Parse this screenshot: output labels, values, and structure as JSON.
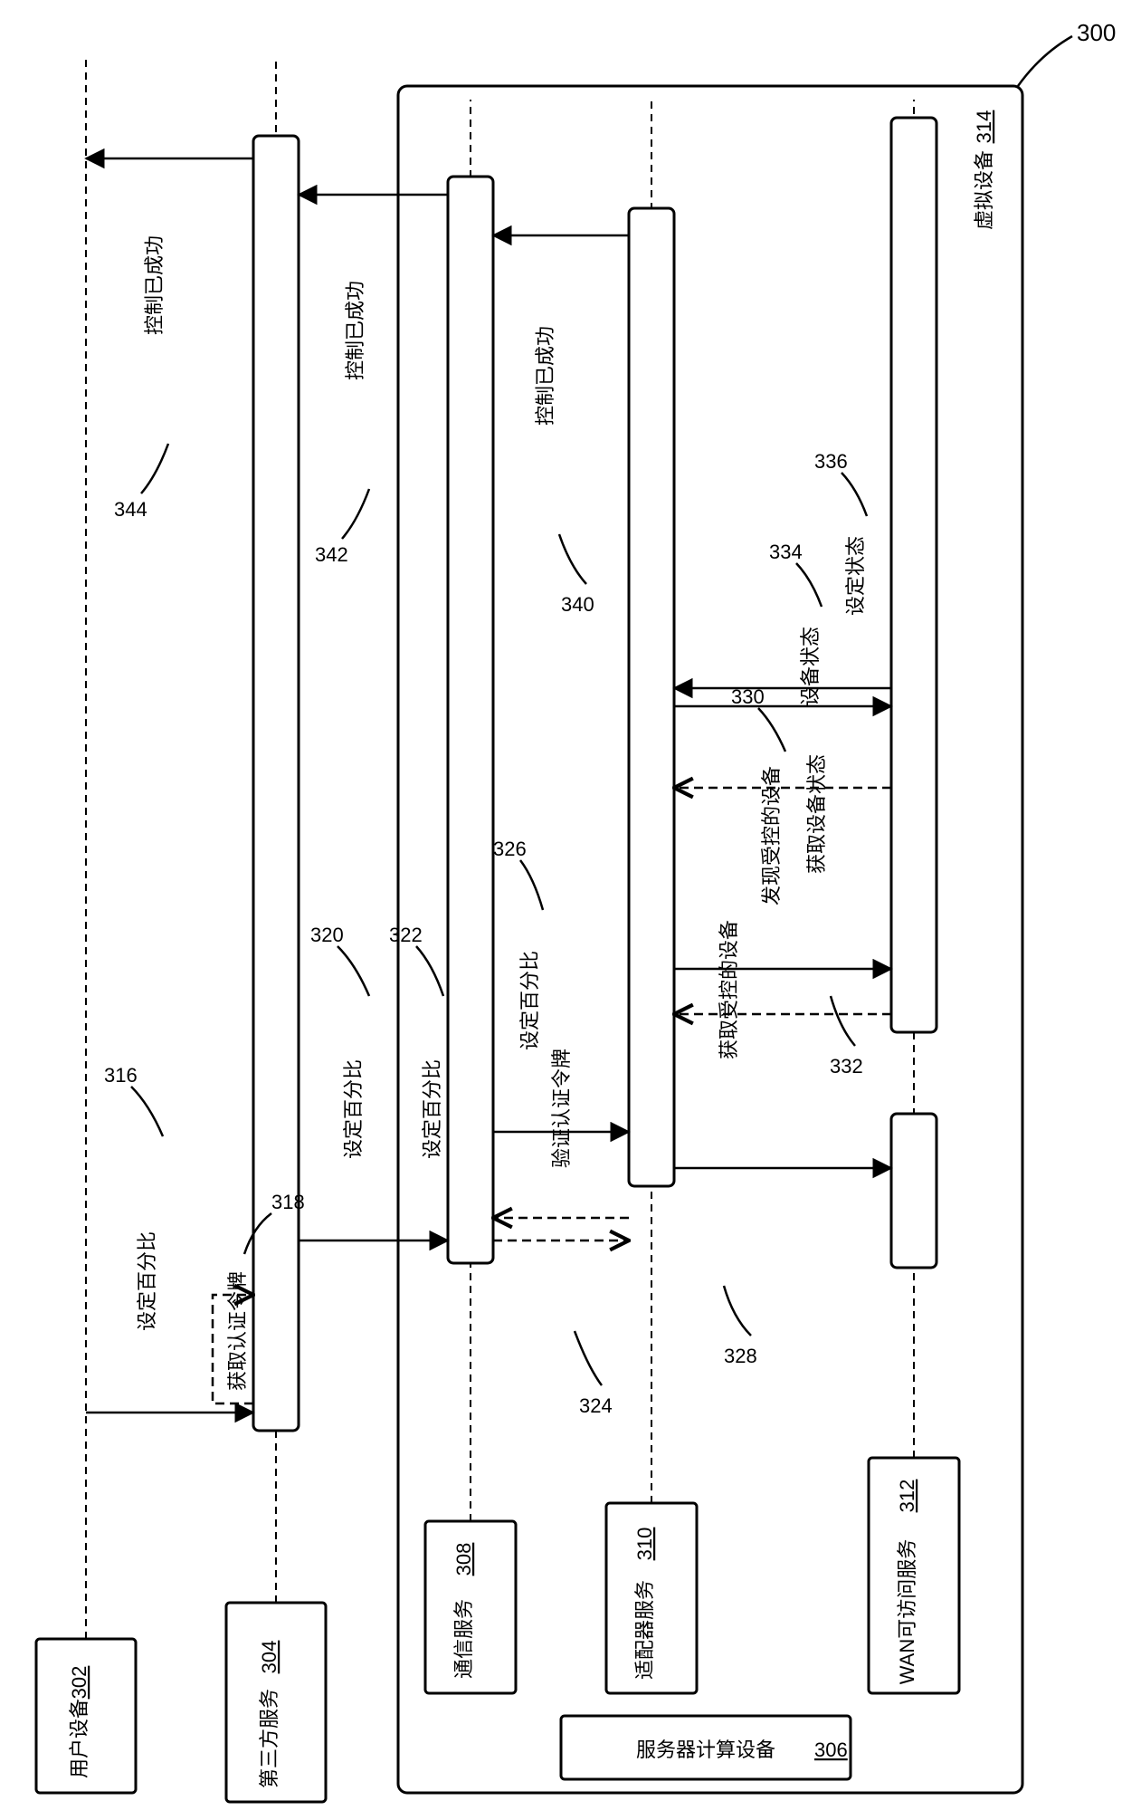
{
  "figure_ref": "300",
  "participants": {
    "user_device": {
      "label": "用户设备",
      "ref": "302"
    },
    "third_party": {
      "label": "第三方服务",
      "ref": "304"
    },
    "server": {
      "label": "服务器计算设备",
      "ref": "306"
    },
    "comm_svc": {
      "label": "通信服务",
      "ref": "308"
    },
    "adapter_svc": {
      "label": "适配器服务",
      "ref": "310"
    },
    "wan_svc": {
      "label": "WAN可访问服务",
      "ref": "312"
    },
    "virtual_dev": {
      "label": "虚拟设备",
      "ref": "314"
    }
  },
  "messages": {
    "m316": {
      "text": "设定百分比",
      "ref": "316"
    },
    "m318": {
      "text": "获取认证令牌",
      "ref": "318"
    },
    "m320": {
      "text": "设定百分比",
      "ref": "320"
    },
    "m322": {
      "text": "设定百分比",
      "ref": "322"
    },
    "m324": {
      "text": "验证认证令牌",
      "ref": "324"
    },
    "m326": {
      "text": "设定百分比",
      "ref": "326"
    },
    "m328": {
      "text": "获取受控的设备",
      "ref": "328"
    },
    "m330": {
      "text": "发现受控的设备",
      "ref": "330"
    },
    "m332": {
      "text": "获取设备状态",
      "ref": "332"
    },
    "m334": {
      "text": "设备状态",
      "ref": "334"
    },
    "m336": {
      "text": "设定状态",
      "ref": "336"
    },
    "m340": {
      "text": "控制已成功",
      "ref": "340"
    },
    "m342": {
      "text": "控制已成功",
      "ref": "342"
    },
    "m344": {
      "text": "控制已成功",
      "ref": "344"
    }
  },
  "chart_data": {
    "type": "sequence-diagram",
    "participants": [
      {
        "id": "user_device",
        "label": "用户设备 302"
      },
      {
        "id": "third_party",
        "label": "第三方服务 304"
      },
      {
        "id": "server",
        "label": "服务器计算设备 306",
        "children": [
          {
            "id": "comm_svc",
            "label": "通信服务 308"
          },
          {
            "id": "adapter_svc",
            "label": "适配器服务 310"
          },
          {
            "id": "wan_svc",
            "label": "WAN可访问服务 312"
          },
          {
            "id": "virtual_dev",
            "label": "虚拟设备 314"
          }
        ]
      }
    ],
    "messages": [
      {
        "ref": "316",
        "from": "user_device",
        "to": "third_party",
        "label": "设定百分比",
        "style": "solid"
      },
      {
        "ref": "318",
        "from": "third_party",
        "to": "third_party",
        "label": "获取认证令牌",
        "style": "dash",
        "self": true
      },
      {
        "ref": "320",
        "from": "third_party",
        "to": "comm_svc",
        "label": "设定百分比",
        "style": "solid"
      },
      {
        "ref": "322",
        "from": "comm_svc",
        "to": "comm_svc",
        "label": "设定百分比",
        "style": "note"
      },
      {
        "ref": "324",
        "from": "comm_svc",
        "to": "adapter_svc",
        "label": "验证认证令牌",
        "style": "dash"
      },
      {
        "ref": "326",
        "from": "comm_svc",
        "to": "adapter_svc",
        "label": "设定百分比",
        "style": "solid"
      },
      {
        "ref": "328",
        "from": "adapter_svc",
        "to": "wan_svc",
        "label": "获取受控的设备",
        "style": "solid"
      },
      {
        "ref": "330",
        "from": "wan_svc",
        "to": "adapter_svc",
        "label": "发现受控的设备",
        "style": "dash"
      },
      {
        "ref": "332",
        "from": "adapter_svc",
        "to": "wan_svc",
        "label": "获取设备状态",
        "style": "solid"
      },
      {
        "ref": "334",
        "from": "wan_svc",
        "to": "adapter_svc",
        "label": "设备状态",
        "style": "dash"
      },
      {
        "ref": "336",
        "from": "adapter_svc",
        "to": "wan_svc",
        "label": "设定状态",
        "style": "double-solid"
      },
      {
        "ref": "340",
        "from": "adapter_svc",
        "to": "comm_svc",
        "label": "控制已成功",
        "style": "solid"
      },
      {
        "ref": "342",
        "from": "comm_svc",
        "to": "third_party",
        "label": "控制已成功",
        "style": "solid"
      },
      {
        "ref": "344",
        "from": "third_party",
        "to": "user_device",
        "label": "控制已成功",
        "style": "solid"
      }
    ]
  }
}
